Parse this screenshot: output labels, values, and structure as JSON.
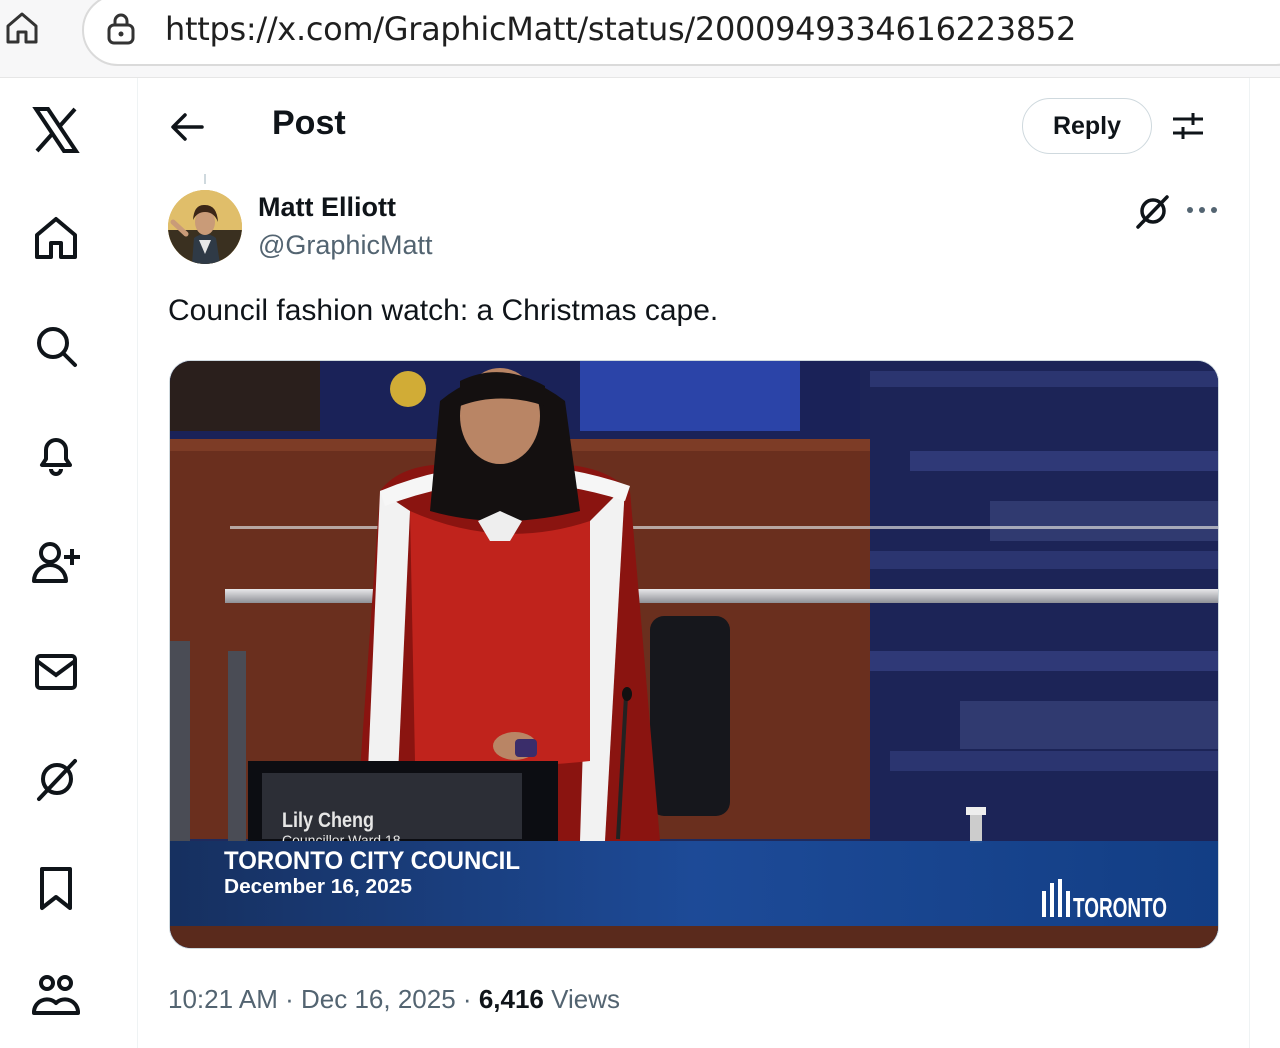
{
  "browser": {
    "url": "https://x.com/GraphicMatt/status/2000949334616223852"
  },
  "nav": {
    "items": [
      "x-logo",
      "home",
      "explore",
      "notifications",
      "follow",
      "messages",
      "grok",
      "bookmarks",
      "communities"
    ]
  },
  "header": {
    "title": "Post",
    "reply_label": "Reply"
  },
  "post": {
    "author_name": "Matt Elliott",
    "author_handle": "@GraphicMatt",
    "text": "Council fashion watch: a Christmas cape.",
    "media": {
      "nameplate_name": "Lily Cheng",
      "nameplate_title": "Councillor Ward 18",
      "banner_title": "TORONTO CITY COUNCIL",
      "banner_date": "December 16, 2025",
      "logo_text": "TORONTO"
    },
    "time": "10:21 AM",
    "date": "Dec 16, 2025",
    "views_count": "6,416",
    "views_label": "Views",
    "separator": "·"
  },
  "colors": {
    "text_primary": "#0f1419",
    "text_secondary": "#536471",
    "border": "#cfd9de",
    "banner_blue": "#123f86"
  }
}
